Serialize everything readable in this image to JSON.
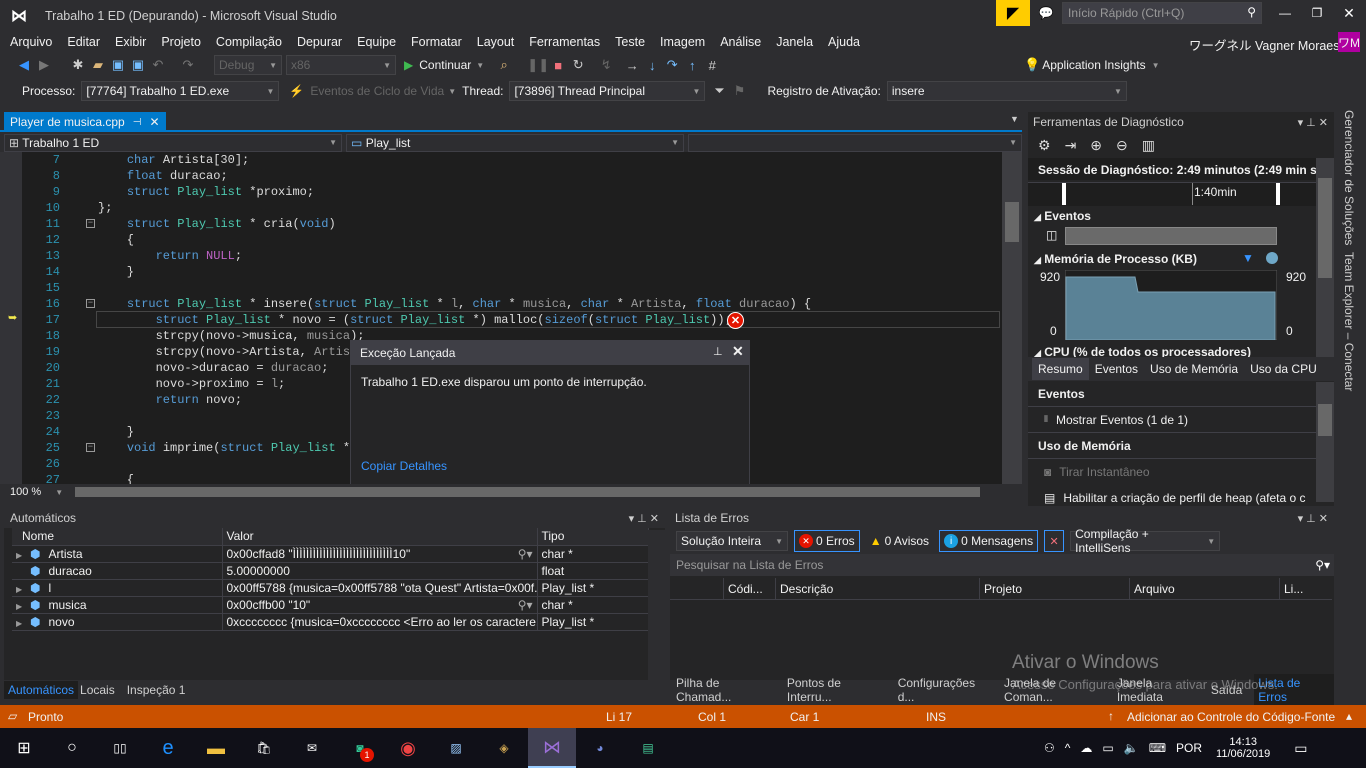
{
  "window": {
    "title": "Trabalho 1 ED (Depurando) - Microsoft Visual Studio",
    "quick_launch": "Início Rápido (Ctrl+Q)",
    "user": "ワーグネル Vagner Moraes",
    "user_initials": "ワM"
  },
  "menu": [
    "Arquivo",
    "Editar",
    "Exibir",
    "Projeto",
    "Compilação",
    "Depurar",
    "Equipe",
    "Formatar",
    "Layout",
    "Ferramentas",
    "Teste",
    "Imagem",
    "Análise",
    "Janela",
    "Ajuda"
  ],
  "toolbar": {
    "config": "Debug",
    "platform": "x86",
    "continue": "Continuar",
    "app_insights": "Application Insights"
  },
  "debugbar": {
    "process_label": "Processo:",
    "process": "[77764] Trabalho 1 ED.exe",
    "lifecycle": "Eventos de Ciclo de Vida",
    "thread_label": "Thread:",
    "thread": "[73896] Thread Principal",
    "stack_label": "Registro de Ativação:",
    "stack": "insere"
  },
  "editor": {
    "tab": "Player de musica.cpp",
    "project": "Trabalho 1 ED",
    "scope": "Play_list",
    "zoom": "100 %",
    "current_line": 17,
    "lines": [
      {
        "n": "7",
        "t": [
          [
            "    "
          ],
          [
            "char",
            "kw"
          ],
          [
            " Artista[30];"
          ]
        ]
      },
      {
        "n": "8",
        "t": [
          [
            "    "
          ],
          [
            "float",
            "kw"
          ],
          [
            " duracao;"
          ]
        ]
      },
      {
        "n": "9",
        "t": [
          [
            "    "
          ],
          [
            "struct",
            "kw"
          ],
          [
            " "
          ],
          [
            "Play_list",
            "ty"
          ],
          [
            " *proximo;"
          ]
        ]
      },
      {
        "n": "10",
        "t": [
          [
            "};"
          ]
        ]
      },
      {
        "n": "11",
        "t": [
          [
            "    "
          ],
          [
            "struct",
            "kw"
          ],
          [
            " "
          ],
          [
            "Play_list",
            "ty"
          ],
          [
            " * cria("
          ],
          [
            "void",
            "kw"
          ],
          [
            ")"
          ]
        ]
      },
      {
        "n": "12",
        "t": [
          [
            "    {"
          ]
        ]
      },
      {
        "n": "13",
        "t": [
          [
            "        "
          ],
          [
            "return",
            "kw"
          ],
          [
            " "
          ],
          [
            "NULL",
            "ma"
          ],
          [
            ";"
          ]
        ]
      },
      {
        "n": "14",
        "t": [
          [
            "    }"
          ]
        ]
      },
      {
        "n": "15",
        "t": [
          [
            ""
          ]
        ]
      },
      {
        "n": "16",
        "t": [
          [
            "    "
          ],
          [
            "struct",
            "kw"
          ],
          [
            " "
          ],
          [
            "Play_list",
            "ty"
          ],
          [
            " * insere("
          ],
          [
            "struct",
            "kw"
          ],
          [
            " "
          ],
          [
            "Play_list",
            "ty"
          ],
          [
            " * "
          ],
          [
            "l",
            "pa"
          ],
          [
            ", "
          ],
          [
            "char",
            "kw"
          ],
          [
            " * "
          ],
          [
            "musica",
            "pa"
          ],
          [
            ", "
          ],
          [
            "char",
            "kw"
          ],
          [
            " * "
          ],
          [
            "Artista",
            "pa"
          ],
          [
            ", "
          ],
          [
            "float",
            "kw"
          ],
          [
            " "
          ],
          [
            "duracao",
            "pa"
          ],
          [
            ") {"
          ]
        ]
      },
      {
        "n": "17",
        "t": [
          [
            "        "
          ],
          [
            "struct",
            "kw"
          ],
          [
            " "
          ],
          [
            "Play_list",
            "ty"
          ],
          [
            " * novo = ("
          ],
          [
            "struct",
            "kw"
          ],
          [
            " "
          ],
          [
            "Play_list",
            "ty"
          ],
          [
            " *) malloc("
          ],
          [
            "sizeof",
            "kw"
          ],
          [
            "("
          ],
          [
            "struct",
            "kw"
          ],
          [
            " "
          ],
          [
            "Play_list",
            "ty"
          ],
          [
            "));"
          ]
        ]
      },
      {
        "n": "18",
        "t": [
          [
            "        strcpy(novo->musica, "
          ],
          [
            "musica",
            "pa"
          ],
          [
            ");"
          ]
        ]
      },
      {
        "n": "19",
        "t": [
          [
            "        strcpy(novo->Artista, "
          ],
          [
            "Artist",
            "pa"
          ]
        ]
      },
      {
        "n": "20",
        "t": [
          [
            "        novo->duracao = "
          ],
          [
            "duracao",
            "pa"
          ],
          [
            ";"
          ]
        ]
      },
      {
        "n": "21",
        "t": [
          [
            "        novo->proximo = "
          ],
          [
            "l",
            "pa"
          ],
          [
            ";"
          ]
        ]
      },
      {
        "n": "22",
        "t": [
          [
            "        "
          ],
          [
            "return",
            "kw"
          ],
          [
            " novo;"
          ]
        ]
      },
      {
        "n": "23",
        "t": [
          [
            ""
          ]
        ]
      },
      {
        "n": "24",
        "t": [
          [
            "    }"
          ]
        ]
      },
      {
        "n": "25",
        "t": [
          [
            "    "
          ],
          [
            "void",
            "kw"
          ],
          [
            " imprime("
          ],
          [
            "struct",
            "kw"
          ],
          [
            " "
          ],
          [
            "Play_list",
            "ty"
          ],
          [
            " *"
          ]
        ]
      },
      {
        "n": "26",
        "t": [
          [
            ""
          ]
        ]
      },
      {
        "n": "27",
        "t": [
          [
            "    {"
          ]
        ]
      }
    ]
  },
  "exception": {
    "title": "Exceção Lançada",
    "message": "Trabalho 1 ED.exe disparou um ponto de interrupção.",
    "link": "Copiar Detalhes"
  },
  "diagnostics": {
    "title": "Ferramentas de Diagnóstico",
    "session": "Sessão de Diagnóstico: 2:49 minutos (2:49 min se...",
    "timeline_label": "1:40min",
    "events": "Eventos",
    "memory": "Memória de Processo (KB)",
    "mem_max": "920",
    "mem_min": "0",
    "cpu": "CPU (% de todos os processadores)",
    "tabs": [
      "Resumo",
      "Eventos",
      "Uso de Memória",
      "Uso da CPU"
    ],
    "sec_events": "Eventos",
    "show_events": "Mostrar Eventos (1 de 1)",
    "sec_memory": "Uso de Memória",
    "snapshot": "Tirar Instantâneo",
    "heap": "Habilitar a criação de perfil de heap (afeta o c"
  },
  "side_tabs": [
    "Gerenciador de Soluções",
    "Team Explorer – Conectar"
  ],
  "autos": {
    "title": "Automáticos",
    "columns": [
      "Nome",
      "Valor",
      "Tipo"
    ],
    "rows": [
      {
        "name": "Artista",
        "value": "0x00cffad8 \"ÌÌÌÌÌÌÌÌÌÌÌÌÌÌÌÌÌÌÌÌÌÌÌÌÌÌÌÌÌÌ10\"",
        "type": "char *",
        "expand": true,
        "viz": true
      },
      {
        "name": "duracao",
        "value": "5.00000000",
        "type": "float",
        "expand": false,
        "viz": false
      },
      {
        "name": "l",
        "value": "0x00ff5788 {musica=0x00ff5788 \"ota Quest\" Artista=0x00f...",
        "type": "Play_list *",
        "expand": true,
        "viz": false
      },
      {
        "name": "musica",
        "value": "0x00cffb00 \"10\"",
        "type": "char *",
        "expand": true,
        "viz": true
      },
      {
        "name": "novo",
        "value": "0xcccccccc {musica=0xcccccccc <Erro ao ler os caractere...",
        "type": "Play_list *",
        "expand": true,
        "viz": false
      }
    ],
    "tabs": [
      "Automáticos",
      "Locais",
      "Inspeção 1"
    ]
  },
  "errors": {
    "title": "Lista de Erros",
    "scope": "Solução Inteira",
    "errors": "0 Erros",
    "warnings": "0 Avisos",
    "messages": "0 Mensagens",
    "source": "Compilação + IntelliSens",
    "search_placeholder": "Pesquisar na Lista de Erros",
    "columns": [
      "",
      "Códi...",
      "Descrição",
      "Projeto",
      "Arquivo",
      "Li..."
    ],
    "tabs": [
      "Pilha de Chamad...",
      "Pontos de Interru...",
      "Configurações d...",
      "Janela de Coman...",
      "Janela Imediata",
      "Saída",
      "Lista de Erros"
    ]
  },
  "watermark": {
    "title": "Ativar o Windows",
    "subtitle": "Acesse Configurações para ativar o Windows."
  },
  "status": {
    "ready": "Pronto",
    "line": "Li 17",
    "col": "Col 1",
    "char": "Car 1",
    "mode": "INS",
    "source_control": "Adicionar ao Controle do Código-Fonte"
  },
  "taskbar": {
    "lang": "POR",
    "time": "14:13",
    "date": "11/06/2019",
    "badge": "1"
  },
  "colors": {
    "accent": "#007acc",
    "status": "#ca5100",
    "error": "#e51400",
    "purple": "#68217a"
  }
}
